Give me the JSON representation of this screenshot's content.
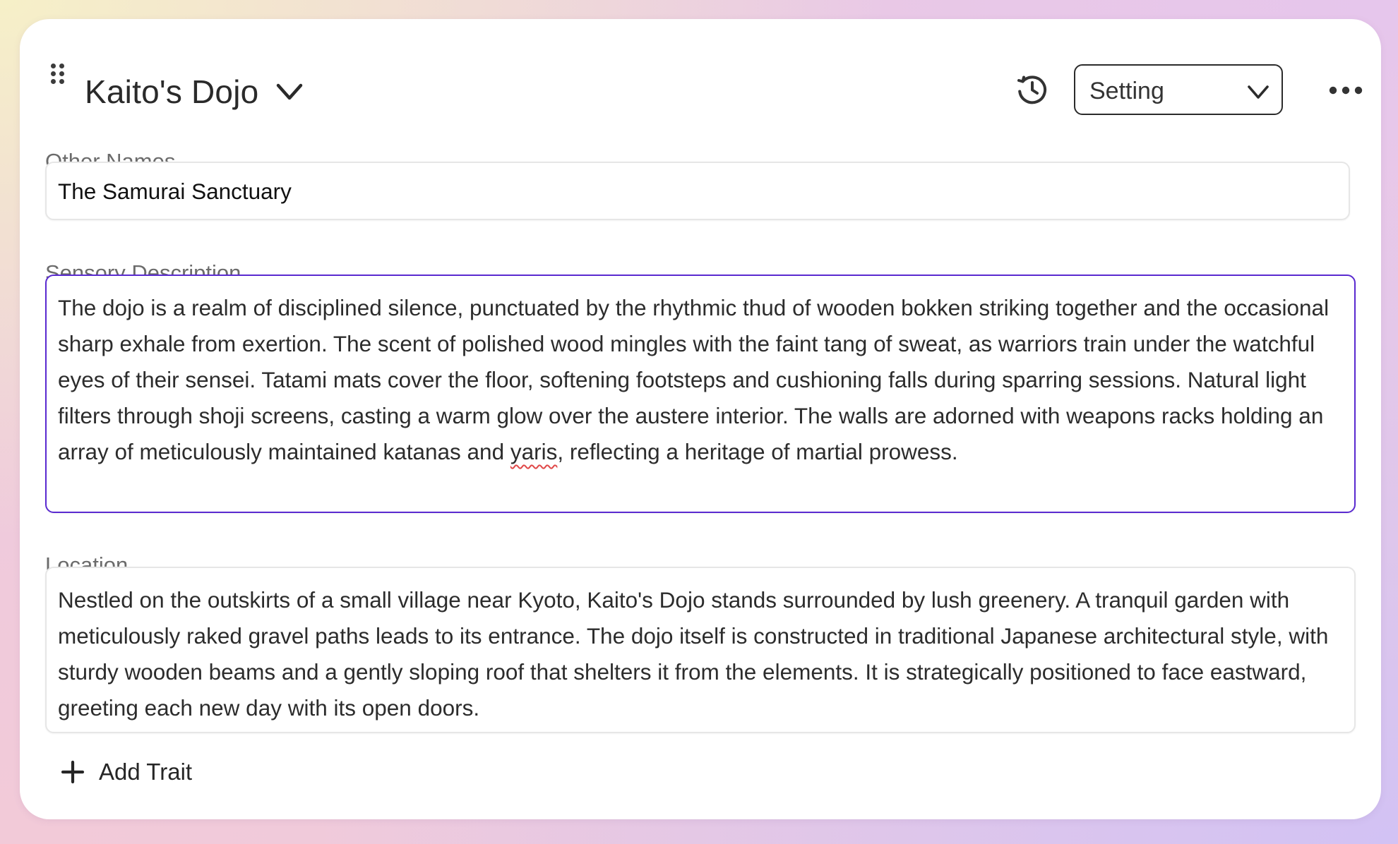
{
  "card": {
    "title": "Kaito's Dojo",
    "type_select": {
      "value": "Setting"
    },
    "icons": {
      "drag": "drag-handle-icon",
      "title_chevron": "chevron-down-icon",
      "history": "history-icon",
      "select_chevron": "chevron-down-icon",
      "more": "more-horizontal-icon",
      "add": "plus-icon"
    }
  },
  "fields": {
    "other_names": {
      "label": "Other Names",
      "value": "The Samurai Sanctuary"
    },
    "sensory_description": {
      "label": "Sensory Description",
      "value_before": "The dojo is a realm of disciplined silence, punctuated by the rhythmic thud of wooden bokken striking together and the occasional sharp exhale from exertion. The scent of polished wood mingles with the faint tang of sweat, as warriors train under the watchful eyes of their sensei. Tatami mats cover the floor, softening footsteps and cushioning falls during sparring sessions. Natural light filters through shoji screens, casting a warm glow over the austere interior. The walls are adorned with weapons racks holding an array of meticulously maintained katanas and ",
      "misspelled_word": "yaris",
      "value_after": ", reflecting a heritage of martial prowess."
    },
    "location": {
      "label": "Location",
      "value": "Nestled on the outskirts of a small village near Kyoto, Kaito's Dojo stands surrounded by lush greenery. A tranquil garden with meticulously raked gravel paths leads to its entrance. The dojo itself is constructed in traditional Japanese architectural style, with sturdy wooden beams and a gently sloping roof that shelters it from the elements. It is strategically positioned to face eastward, greeting each new day with its open doors."
    }
  },
  "actions": {
    "add_trait_label": "Add Trait"
  },
  "colors": {
    "focus_border": "#5a2ad0",
    "text": "#2c2c2c",
    "label": "#6b6b6b",
    "spellcheck": "#e04848"
  }
}
